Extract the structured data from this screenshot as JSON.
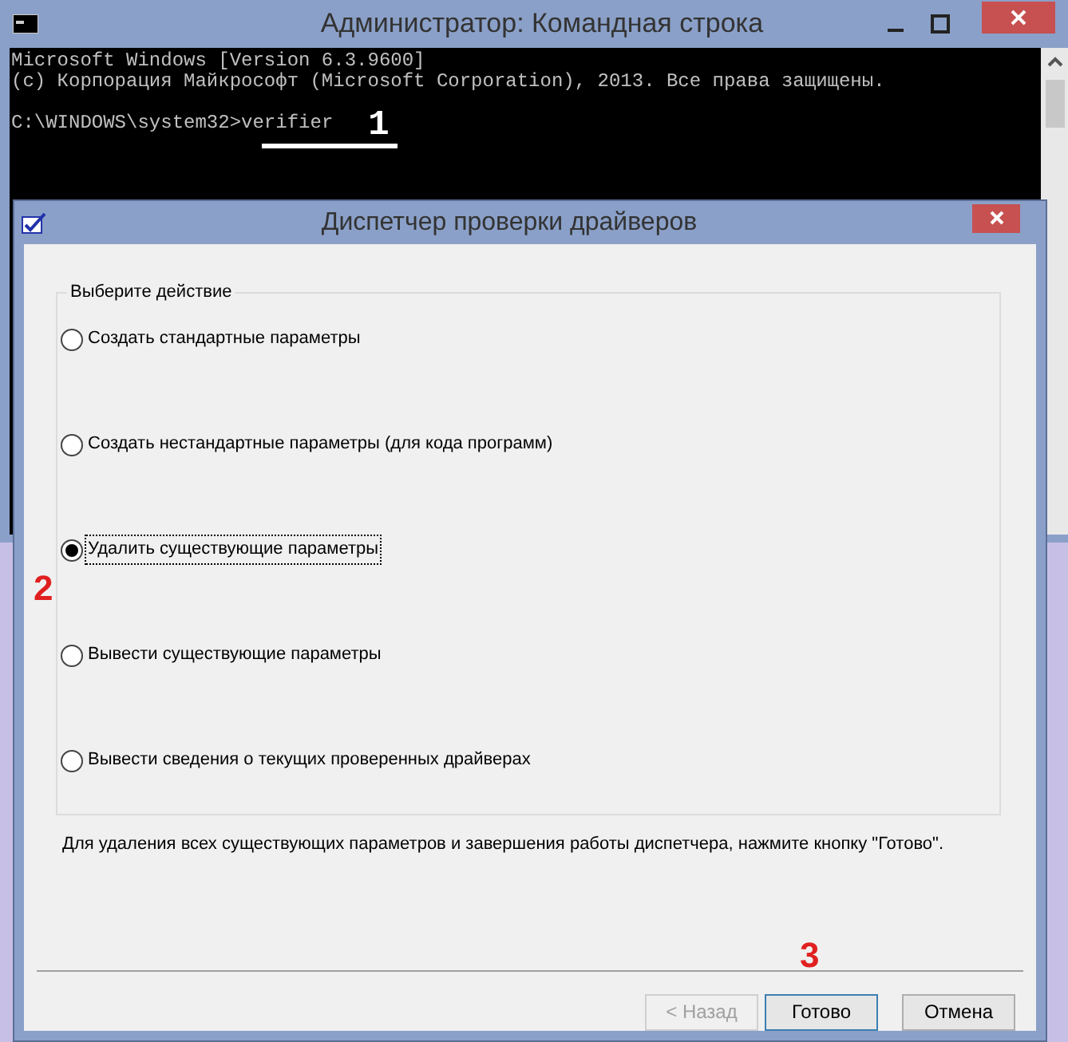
{
  "console_window": {
    "title": "Администратор: Командная строка",
    "lines": [
      "Microsoft Windows [Version 6.3.9600]",
      "(c) Корпорация Майкрософт (Microsoft Corporation), 2013. Все права защищены."
    ],
    "prompt": "C:\\WINDOWS\\system32>",
    "command": "verifier"
  },
  "dialog": {
    "title": "Диспетчер проверки драйверов",
    "group_label": "Выберите действие",
    "options": [
      {
        "label": "Создать стандартные параметры",
        "selected": false
      },
      {
        "label": "Создать нестандартные параметры (для кода программ)",
        "selected": false
      },
      {
        "label": "Удалить существующие параметры",
        "selected": true
      },
      {
        "label": "Вывести существующие параметры",
        "selected": false
      },
      {
        "label": "Вывести сведения о текущих проверенных драйверах",
        "selected": false
      }
    ],
    "description": "Для удаления всех существующих параметров и завершения работы диспетчера, нажмите кнопку \"Готово\".",
    "buttons": [
      {
        "label": "< Назад",
        "disabled": true,
        "default": false
      },
      {
        "label": "Готово",
        "disabled": false,
        "default": true
      },
      {
        "label": "Отмена",
        "disabled": false,
        "default": false
      }
    ]
  },
  "annotations": [
    {
      "text": "1",
      "color": "#ffffff"
    },
    {
      "text": "2",
      "color": "#e02020"
    },
    {
      "text": "3",
      "color": "#e02020"
    }
  ]
}
